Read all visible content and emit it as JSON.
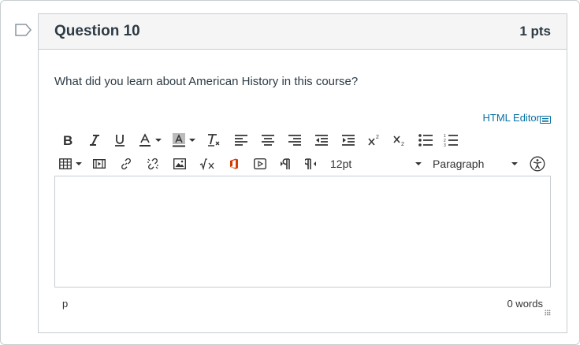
{
  "question": {
    "title": "Question 10",
    "points": "1 pts",
    "text": "What did you learn about American History in this course?"
  },
  "editor": {
    "html_editor_label": "HTML Editor",
    "font_size": "12pt",
    "block_format": "Paragraph",
    "path": "p",
    "word_count": "0 words",
    "content": ""
  },
  "toolbar_row1": [
    "bold-icon",
    "italic-icon",
    "underline-icon",
    "text-color-icon",
    "background-color-icon",
    "clear-formatting-icon",
    "align-left-icon",
    "align-center-icon",
    "align-right-icon",
    "outdent-icon",
    "indent-icon",
    "superscript-icon",
    "subscript-icon",
    "bullet-list-icon",
    "numbered-list-icon"
  ],
  "toolbar_row2": [
    "table-icon",
    "media-icon",
    "link-icon",
    "unlink-icon",
    "image-icon",
    "math-icon",
    "office-icon",
    "embed-icon",
    "ltr-paragraph-icon",
    "rtl-paragraph-icon",
    "accessibility-icon"
  ],
  "colors": {
    "header_bg": "#f5f5f5",
    "border": "#c7cdd1",
    "link": "#0770a3",
    "office": "#d83b01",
    "text": "#2d3b45"
  }
}
